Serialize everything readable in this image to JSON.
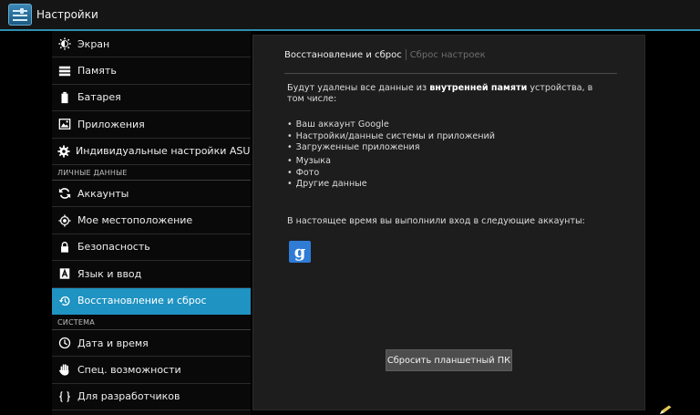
{
  "app": {
    "title": "Настройки"
  },
  "menu": {
    "items_top": [
      {
        "label": "Экран",
        "icon": "brightness-icon"
      },
      {
        "label": "Память",
        "icon": "storage-icon"
      },
      {
        "label": "Батарея",
        "icon": "battery-icon"
      },
      {
        "label": "Приложения",
        "icon": "apps-icon"
      },
      {
        "label": "Индивидуальные настройки ASUS",
        "icon": "gear-icon"
      }
    ],
    "section_personal": "ЛИЧНЫЕ ДАННЫЕ",
    "items_personal": [
      {
        "label": "Аккаунты",
        "icon": "sync-icon"
      },
      {
        "label": "Мое местоположение",
        "icon": "location-icon"
      },
      {
        "label": "Безопасность",
        "icon": "lock-icon"
      },
      {
        "label": "Язык и ввод",
        "icon": "keyboard-icon"
      },
      {
        "label": "Восстановление и сброс",
        "icon": "restore-icon",
        "selected": true
      }
    ],
    "section_system": "СИСТЕМА",
    "items_system": [
      {
        "label": "Дата и время",
        "icon": "clock-icon"
      },
      {
        "label": "Спец. возможности",
        "icon": "hand-icon"
      },
      {
        "label": "Для разработчиков",
        "icon": "braces-icon"
      }
    ]
  },
  "detail": {
    "breadcrumb_active": "Восстановление и сброс",
    "breadcrumb_inactive": "Сброс настроек",
    "warning_before": "Будут удалены все данные из ",
    "warning_bold": "внутренней памяти",
    "warning_after": " устройства, в том числе:",
    "bullets": [
      "Ваш аккаунт Google",
      "Настройки/данные системы и приложений",
      "Загруженные приложения",
      "Музыка",
      "Фото",
      "Другие данные"
    ],
    "accounts_text": "В настоящее время вы выполнили вход в следующие аккаунты:",
    "google_glyph": "g",
    "reset_button": "Сбросить планшетный ПК"
  },
  "colors": {
    "accent": "#2d8fb0",
    "selected_bg": "#1f93c2",
    "pane_bg": "#1d1d1d",
    "google_blue": "#2f7bd6"
  }
}
